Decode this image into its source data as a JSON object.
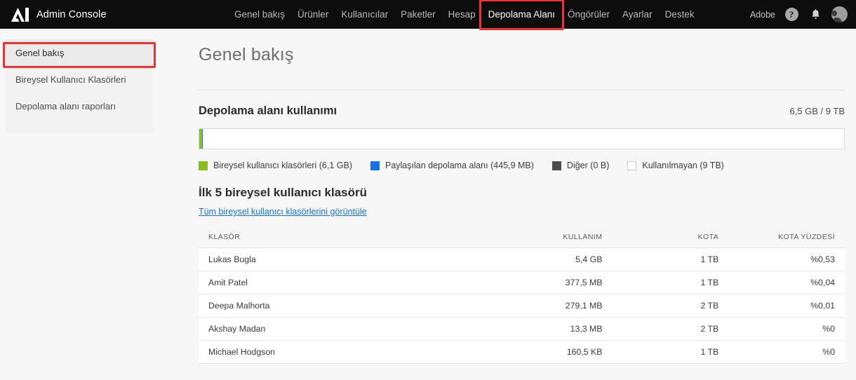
{
  "topbar": {
    "logo_icon": "adobe-logo-icon",
    "brand": "Admin Console",
    "nav": [
      {
        "label": "Genel bakış",
        "active": false
      },
      {
        "label": "Ürünler",
        "active": false
      },
      {
        "label": "Kullanıcılar",
        "active": false
      },
      {
        "label": "Paketler",
        "active": false
      },
      {
        "label": "Hesap",
        "active": false
      },
      {
        "label": "Depolama Alanı",
        "active": true
      },
      {
        "label": "Öngörüler",
        "active": false
      },
      {
        "label": "Ayarlar",
        "active": false
      },
      {
        "label": "Destek",
        "active": false
      }
    ],
    "org_label": "Adobe",
    "help_glyph": "?",
    "bell_glyph": " "
  },
  "sidebar": {
    "items": [
      {
        "label": "Genel bakış",
        "selected": true
      },
      {
        "label": "Bireysel Kullanıcı Klasörleri",
        "selected": false
      },
      {
        "label": "Depolama alanı raporları",
        "selected": false
      }
    ]
  },
  "main": {
    "page_title": "Genel bakış",
    "storage": {
      "title": "Depolama alanı kullanımı",
      "summary": "6,5 GB / 9 TB",
      "legend": [
        {
          "label": "Bireysel kullanıcı klasörleri (6,1 GB)",
          "color": "#87bf20"
        },
        {
          "label": "Paylaşılan depolama alanı (445,9 MB)",
          "color": "#1473e6"
        },
        {
          "label": "Diğer (0 B)",
          "color": "#4b4b4b"
        },
        {
          "label": "Kullanılmayan (9 TB)",
          "color": "#ffffff"
        }
      ]
    },
    "top_folders": {
      "title": "İlk 5 bireysel kullanıcı klasörü",
      "link": "Tüm bireysel kullanıcı klasörlerini görüntüle",
      "columns": [
        "KLASÖR",
        "KULLANIM",
        "KOTA",
        "KOTA YÜZDESİ"
      ],
      "rows": [
        {
          "folder": "Lukas Bugla",
          "usage": "5,4 GB",
          "quota": "1 TB",
          "pct": "%0,53"
        },
        {
          "folder": "Amit Patel",
          "usage": "377,5 MB",
          "quota": "1 TB",
          "pct": "%0,04"
        },
        {
          "folder": "Deepa Malhorta",
          "usage": "279,1 MB",
          "quota": "2 TB",
          "pct": "%0,01"
        },
        {
          "folder": "Akshay Madan",
          "usage": "13,3 MB",
          "quota": "2 TB",
          "pct": "%0"
        },
        {
          "folder": "Michael Hodgson",
          "usage": "160,5 KB",
          "quota": "1 TB",
          "pct": "%0"
        }
      ]
    }
  },
  "chart_data": {
    "type": "bar",
    "title": "Depolama alanı kullanımı",
    "categories": [
      "Bireysel kullanıcı klasörleri",
      "Paylaşılan depolama alanı",
      "Diğer",
      "Kullanılmayan"
    ],
    "values_label": [
      "6,1 GB",
      "445,9 MB",
      "0 B",
      "9 TB"
    ],
    "values_bytes": [
      6100000000,
      445900000,
      0,
      9000000000000
    ],
    "total_label": "9 TB",
    "used_label": "6,5 GB",
    "colors": [
      "#87bf20",
      "#1473e6",
      "#4b4b4b",
      "#ffffff"
    ],
    "orientation": "horizontal-stacked",
    "legend_position": "below"
  }
}
